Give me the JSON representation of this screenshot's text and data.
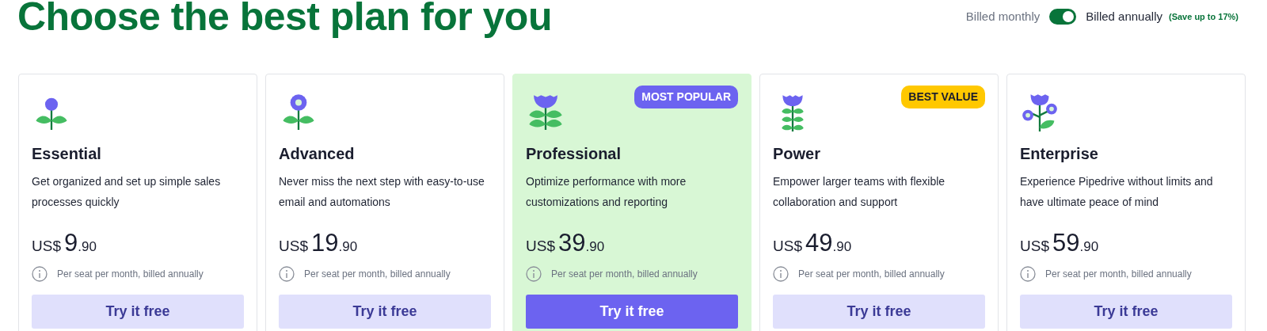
{
  "heading": "Choose the best plan for you",
  "billing": {
    "monthly_label": "Billed monthly",
    "annual_label": "Billed annually",
    "savings": "(Save up to 17%)",
    "annual": true
  },
  "plans": [
    {
      "name": "Essential",
      "description": "Get organized and set up simple sales processes quickly",
      "currency": "US$",
      "price_whole": "9",
      "price_cents": ".90",
      "note": "Per seat per month, billed annually",
      "button": "Try it free",
      "highlighted": false
    },
    {
      "name": "Advanced",
      "description": "Never miss the next step with easy-to-use email and automations",
      "currency": "US$",
      "price_whole": "19",
      "price_cents": ".90",
      "note": "Per seat per month, billed annually",
      "button": "Try it free",
      "highlighted": false
    },
    {
      "name": "Professional",
      "badge": {
        "text": "MOST POPULAR",
        "kind": "popular"
      },
      "description": "Optimize performance with more customizations and reporting",
      "currency": "US$",
      "price_whole": "39",
      "price_cents": ".90",
      "note": "Per seat per month, billed annually",
      "button": "Try it free",
      "highlighted": true
    },
    {
      "name": "Power",
      "badge": {
        "text": "BEST VALUE",
        "kind": "value"
      },
      "description": "Empower larger teams with flexible collaboration and support",
      "currency": "US$",
      "price_whole": "49",
      "price_cents": ".90",
      "note": "Per seat per month, billed annually",
      "button": "Try it free",
      "highlighted": false
    },
    {
      "name": "Enterprise",
      "description": "Experience Pipedrive without limits and have ultimate peace of mind",
      "currency": "US$",
      "price_whole": "59",
      "price_cents": ".90",
      "note": "Per seat per month, billed annually",
      "button": "Try it free",
      "highlighted": false
    }
  ]
}
